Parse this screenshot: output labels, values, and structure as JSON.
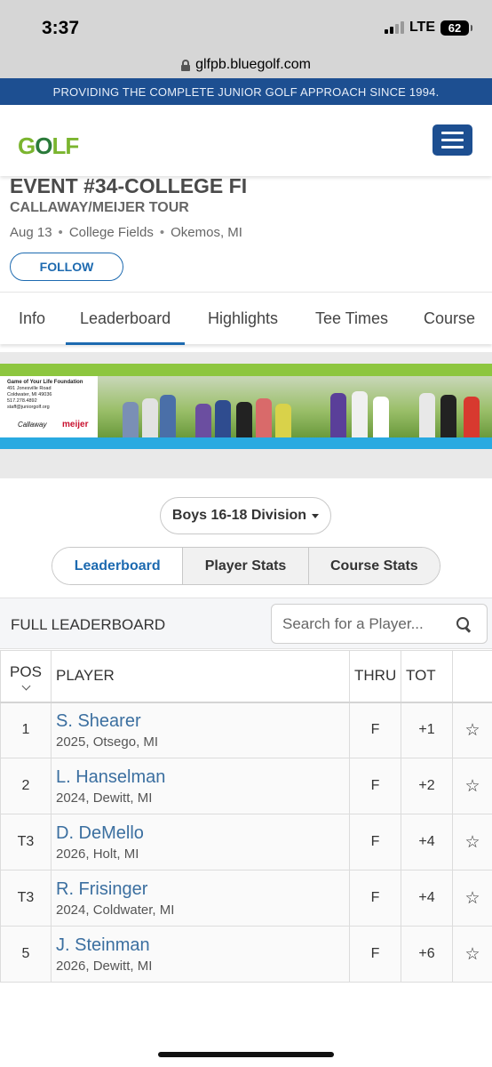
{
  "status_bar": {
    "time": "3:37",
    "network": "LTE",
    "battery": "62"
  },
  "browser": {
    "url": "glfpb.bluegolf.com"
  },
  "banner": {
    "text": "PROVIDING THE COMPLETE JUNIOR GOLF APPROACH SINCE 1994."
  },
  "header": {
    "logo_text": "GOLF"
  },
  "event": {
    "title": "EVENT #34-COLLEGE FI",
    "tour": "CALLAWAY/MEIJER TOUR",
    "date": "Aug 13",
    "course": "College Fields",
    "location": "Okemos, MI",
    "follow_label": "FOLLOW"
  },
  "tabs": [
    {
      "label": "Info"
    },
    {
      "label": "Leaderboard"
    },
    {
      "label": "Highlights"
    },
    {
      "label": "Tee Times"
    },
    {
      "label": "Course"
    }
  ],
  "ad": {
    "foundation_name": "Game of Your Life Foundation",
    "address1": "491 Jonesville Road",
    "address2": "Coldwater, MI 49036",
    "phone": "517.278.4892",
    "email": "staff@juniorgolf.org",
    "sponsor1": "Callaway",
    "sponsor2": "meijer"
  },
  "division": {
    "selected": "Boys 16-18 Division"
  },
  "segments": [
    {
      "label": "Leaderboard"
    },
    {
      "label": "Player Stats"
    },
    {
      "label": "Course Stats"
    }
  ],
  "leaderboard": {
    "title": "FULL LEADERBOARD",
    "search_placeholder": "Search for a Player...",
    "columns": {
      "pos": "POS",
      "player": "PLAYER",
      "thru": "THRU",
      "tot": "TOT"
    },
    "rows": [
      {
        "pos": "1",
        "name": "S. Shearer",
        "info": "2025, Otsego, MI",
        "thru": "F",
        "tot": "+1"
      },
      {
        "pos": "2",
        "name": "L. Hanselman",
        "info": "2024, Dewitt, MI",
        "thru": "F",
        "tot": "+2"
      },
      {
        "pos": "T3",
        "name": "D. DeMello",
        "info": "2026, Holt, MI",
        "thru": "F",
        "tot": "+4"
      },
      {
        "pos": "T3",
        "name": "R. Frisinger",
        "info": "2024, Coldwater, MI",
        "thru": "F",
        "tot": "+4"
      },
      {
        "pos": "5",
        "name": "J. Steinman",
        "info": "2026, Dewitt, MI",
        "thru": "F",
        "tot": "+6"
      }
    ]
  },
  "colors": {
    "brand_blue": "#1d4f91",
    "link_blue": "#1d6ab0",
    "logo_green": "#7bb52f"
  },
  "icons": {
    "favorite": "star-outline-icon",
    "search": "search-icon",
    "menu": "hamburger-menu-icon"
  }
}
